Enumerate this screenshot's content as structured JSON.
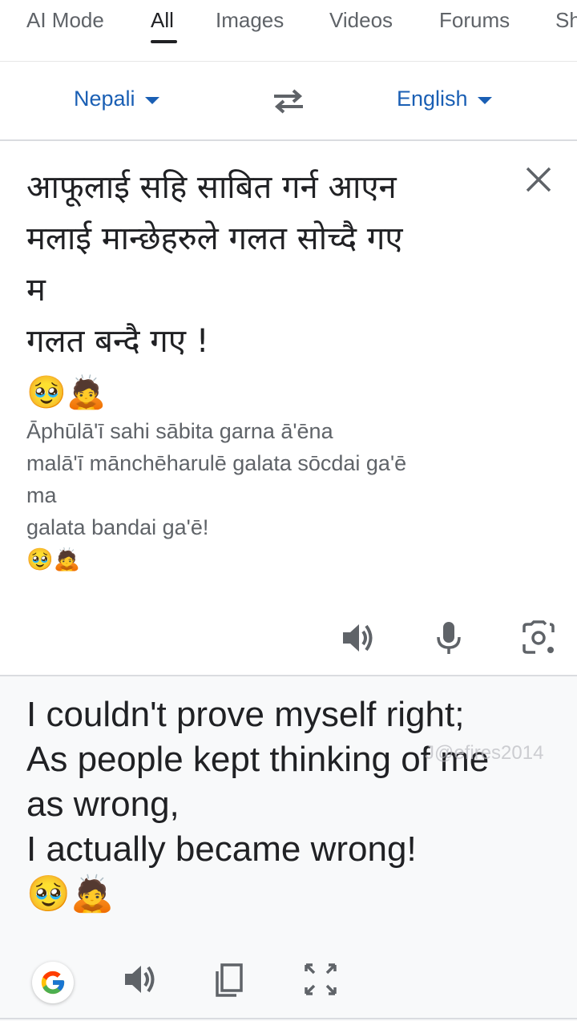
{
  "tabs": [
    {
      "label": "AI Mode"
    },
    {
      "label": "All"
    },
    {
      "label": "Images"
    },
    {
      "label": "Videos"
    },
    {
      "label": "Forums"
    },
    {
      "label": "Sh"
    }
  ],
  "active_tab": "All",
  "language_bar": {
    "source_language": "Nepali",
    "target_language": "English",
    "accent_color": "#1a5fb4"
  },
  "source": {
    "text": "आफूलाई सहि साबित गर्न आएन\nमलाई मान्छेहरुले गलत सोच्दै गए\nम\nगलत बन्दै गए !\n🥹🙇",
    "transliteration": "Āphūlā'ī sahi sābita garna ā'ēna\nmalā'ī mānchēharulē galata sōcdai ga'ē\nma\ngalata bandai ga'ē!\n🥹🙇",
    "actions": [
      "speaker-icon",
      "microphone-icon",
      "camera-icon"
    ]
  },
  "translation": {
    "text": "I couldn't prove myself right;\nAs people kept thinking of me\nas wrong,\nI actually became wrong!\n🥹🙇",
    "watermark": "J@efires2014",
    "actions": [
      "google-icon",
      "speaker-icon",
      "copy-icon",
      "fullscreen-icon"
    ]
  }
}
